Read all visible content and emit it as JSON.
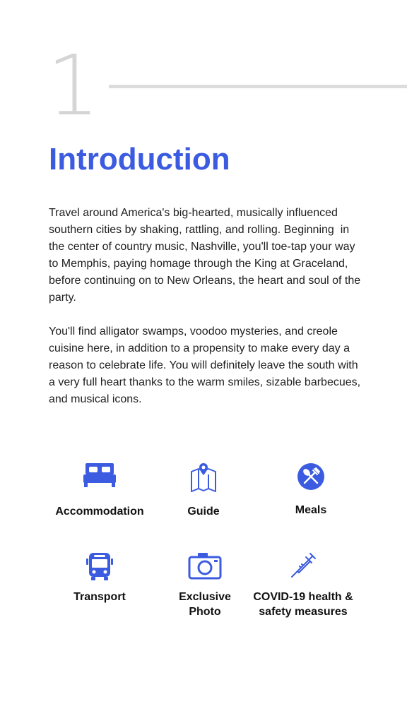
{
  "section": {
    "number": "1",
    "title": "Introduction"
  },
  "paragraphs": [
    "Travel around America's big-hearted, musically influenced southern cities by shaking, rattling, and rolling. Beginning  in the center of country music, Nashville, you'll toe-tap your way to Memphis, paying homage through the King at Graceland, before continuing on to New Orleans, the heart and soul of the party.",
    "You'll find alligator swamps, voodoo mysteries, and creole cuisine here, in addition to a propensity to make every day a reason to celebrate life. You will definitely leave the south with a very full heart thanks to the warm smiles, sizable barbecues, and musical icons."
  ],
  "features": [
    {
      "label": "Accommodation",
      "icon": "bed-icon"
    },
    {
      "label": "Guide",
      "icon": "map-pin-icon"
    },
    {
      "label": "Meals",
      "icon": "fork-spoon-icon"
    },
    {
      "label": "Transport",
      "icon": "bus-icon"
    },
    {
      "label": "Exclusive Photo",
      "icon": "camera-icon"
    },
    {
      "label": "COVID-19 health & safety measures",
      "icon": "syringe-icon"
    }
  ],
  "colors": {
    "accent": "#3b5be0",
    "number": "#d5d5d5",
    "rule": "#dcdcdc"
  }
}
